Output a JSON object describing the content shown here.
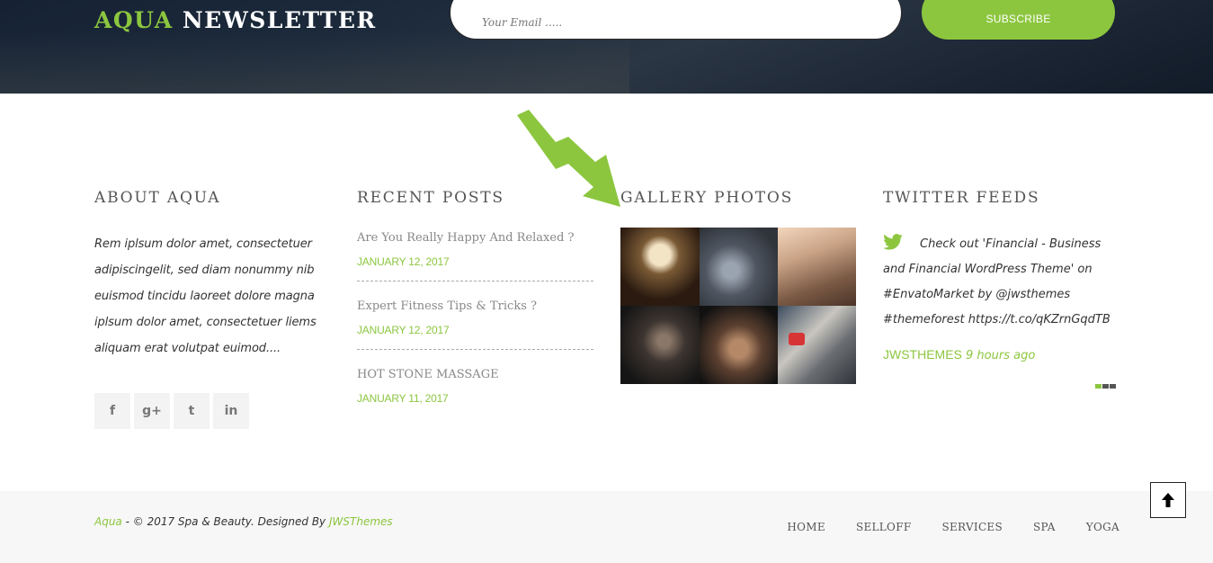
{
  "newsletter": {
    "title_accent": "AQUA",
    "title_rest": "NEWSLETTER",
    "email_placeholder": "Your Email .....",
    "subscribe_label": "SUBSCRIBE"
  },
  "about": {
    "title": "ABOUT AQUA",
    "text": "Rem iplsum dolor amet, consectetuer adipiscingelit, sed diam nonummy nib euismod tincidu laoreet dolore magna iplsum dolor amet, consectetuer liems aliquam erat volutpat euimod....",
    "socials": [
      {
        "icon": "facebook-icon",
        "glyph": "f"
      },
      {
        "icon": "google-plus-icon",
        "glyph": "g+"
      },
      {
        "icon": "twitter-icon",
        "glyph": "t"
      },
      {
        "icon": "linkedin-icon",
        "glyph": "in"
      }
    ]
  },
  "recent_posts": {
    "title": "RECENT POSTS",
    "items": [
      {
        "title": "Are You Really Happy And Relaxed ?",
        "date": "JANUARY 12, 2017"
      },
      {
        "title": "Expert Fitness Tips & Tricks ?",
        "date": "JANUARY 12, 2017"
      },
      {
        "title": "HOT STONE MASSAGE",
        "date": "JANUARY 11, 2017"
      }
    ]
  },
  "gallery": {
    "title": "GALLERY PHOTOS"
  },
  "twitter": {
    "title": "TWITTER FEEDS",
    "tweet": "Check out 'Financial - Business and Financial WordPress Theme' on #EnvatoMarket by @jwsthemes #themeforest https://t.co/qKZrnGqdTB",
    "handle": "JWSTHEMES",
    "time": "9 hours ago"
  },
  "footer": {
    "brand": "Aqua",
    "copyright_mid": " - © 2017 Spa & Beauty. Designed By ",
    "designer": "JWSThemes",
    "nav": [
      "HOME",
      "SELLOFF",
      "SERVICES",
      "SPA",
      "YOGA"
    ]
  },
  "colors": {
    "accent": "#8cc63f",
    "dark_band": "#1c2a3b"
  }
}
